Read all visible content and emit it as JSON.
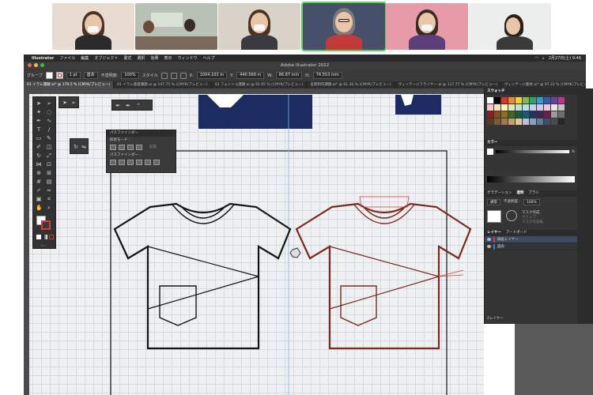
{
  "menubar": {
    "app": "Illustrator",
    "items": [
      "ファイル",
      "編集",
      "オブジェクト",
      "書式",
      "選択",
      "効果",
      "表示",
      "ウィンドウ",
      "ヘルプ"
    ],
    "datetime": "2月27日(土) 9:46"
  },
  "window": {
    "title": "Adobe Illustrator 2022"
  },
  "controlbar": {
    "selection_label": "グループ",
    "stroke_weight": "1 pt",
    "stroke_profile": "基本",
    "opacity_label": "不透明度:",
    "opacity_value": "100%",
    "style_label": "スタイル",
    "x_label": "X:",
    "x_value": "1004.103 m",
    "y_label": "Y:",
    "y_value": "440.569 m",
    "w_label": "W:",
    "w_value": "86.87 mm",
    "h_label": "H:",
    "h_value": "74.553 mm"
  },
  "tabs": [
    "01 イラレ課題.ai* @ 179.5 % (CMYK/プレビュー)",
    "01 イラレ基礎課題.ai @ 147.75 % (CMYK/プレビュー)",
    "02 フォトショ課題.ai @ 92.65 % (CMYK/プレビュー)",
    "名刺制作課題.ai* @ 61.36 % (CMYK/プレビュー)",
    "ヴィンテージフライヤー.ai @ 117.77 % (CMYK/プレビュー)",
    "ヴィンテージ素材.ai* @ 97.22 % (CMYK/プレビュー)"
  ],
  "pathfinder": {
    "title": "パスファインダー",
    "shape_modes": "形状モード :",
    "expand": "拡張",
    "pathfinders": "パスファインダー :"
  },
  "dock": {
    "swatches_title": "スウォッチ",
    "color_title": "カラー",
    "color_percent": "%",
    "gradient_tab": "グラデーション",
    "transparency_tab": "透明",
    "brush_tab": "ブラシ",
    "blend_mode": "通常",
    "opacity_label": "不透明度 :",
    "opacity_value": "100%",
    "mask_button": "マスク作成",
    "clip_label": "クリップ",
    "invert_label": "マスクを反転",
    "layers_tab": "レイヤー",
    "artboards_tab": "アートボード",
    "layers": [
      "線画レイヤー",
      "図表"
    ],
    "layer_count": "2レイヤー"
  },
  "colors": {
    "accent_active": "#5ad25a",
    "line_black": "#141414",
    "line_dark_red": "#7a2a22",
    "selection_red": "#d23c3c",
    "navy": "#1d2b63"
  }
}
